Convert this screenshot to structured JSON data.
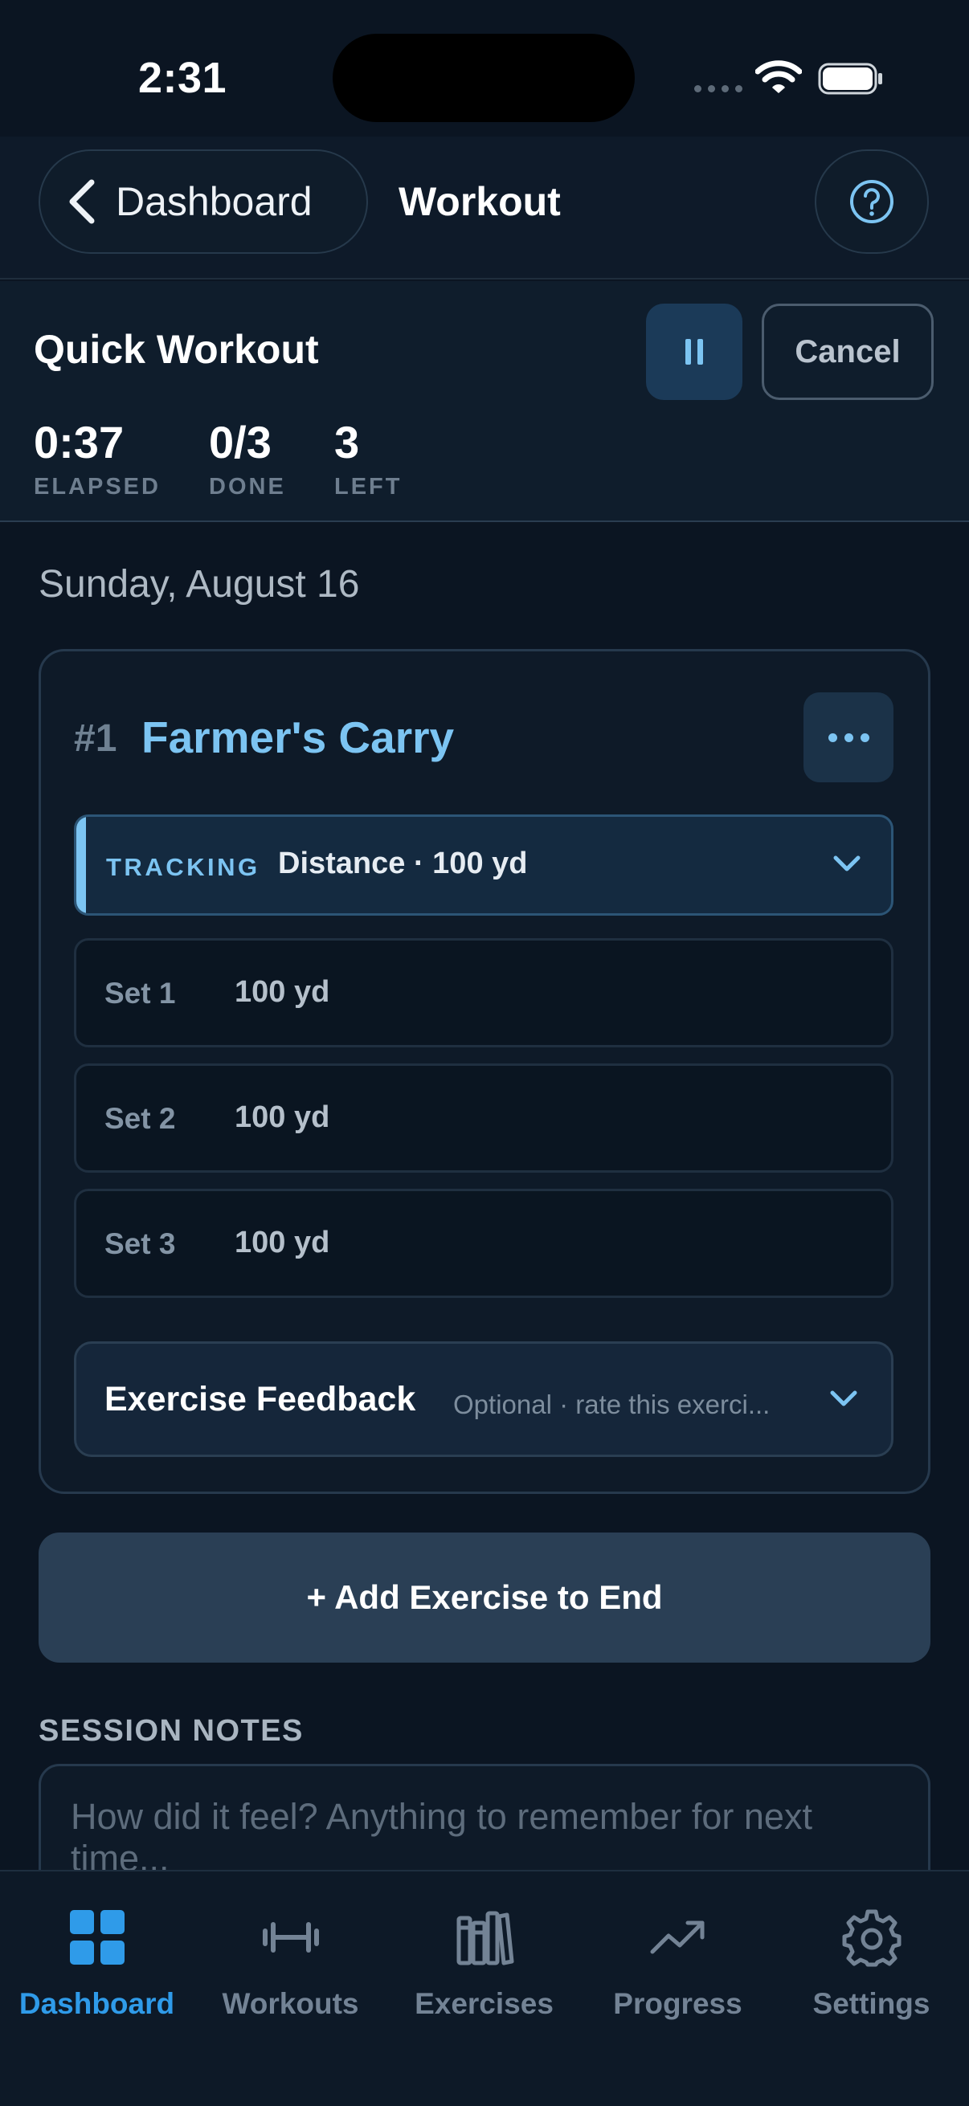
{
  "status_bar": {
    "time": "2:31"
  },
  "nav": {
    "back_label": "Dashboard",
    "title": "Workout",
    "help_icon": "question-circle-icon"
  },
  "workout": {
    "title": "Quick Workout",
    "cancel_label": "Cancel",
    "stats": [
      {
        "value": "0:37",
        "label": "ELAPSED"
      },
      {
        "value": "0/3",
        "label": "DONE"
      },
      {
        "value": "3",
        "label": "LEFT"
      }
    ]
  },
  "date": "Sunday, August 16",
  "exercise": {
    "number": "#1",
    "name": "Farmer's Carry",
    "tracking_label": "TRACKING",
    "tracking_value": "Distance · 100 yd",
    "sets": [
      {
        "label": "Set 1",
        "value": "100 yd"
      },
      {
        "label": "Set 2",
        "value": "100 yd"
      },
      {
        "label": "Set 3",
        "value": "100 yd"
      }
    ],
    "feedback_title": "Exercise Feedback",
    "feedback_hint": "Optional · rate this exerci..."
  },
  "add_exercise_label": "+ Add Exercise to End",
  "notes": {
    "heading": "SESSION NOTES",
    "placeholder": "How did it feel? Anything to remember for next time..."
  },
  "tabs": [
    {
      "label": "Dashboard",
      "icon": "grid-icon",
      "active": true
    },
    {
      "label": "Workouts",
      "icon": "dumbbell-icon",
      "active": false
    },
    {
      "label": "Exercises",
      "icon": "books-icon",
      "active": false
    },
    {
      "label": "Progress",
      "icon": "trend-up-icon",
      "active": false
    },
    {
      "label": "Settings",
      "icon": "gear-icon",
      "active": false
    }
  ],
  "colors": {
    "accent": "#7cc4f2",
    "tab_active": "#2f9be9",
    "background": "#0b1522"
  }
}
